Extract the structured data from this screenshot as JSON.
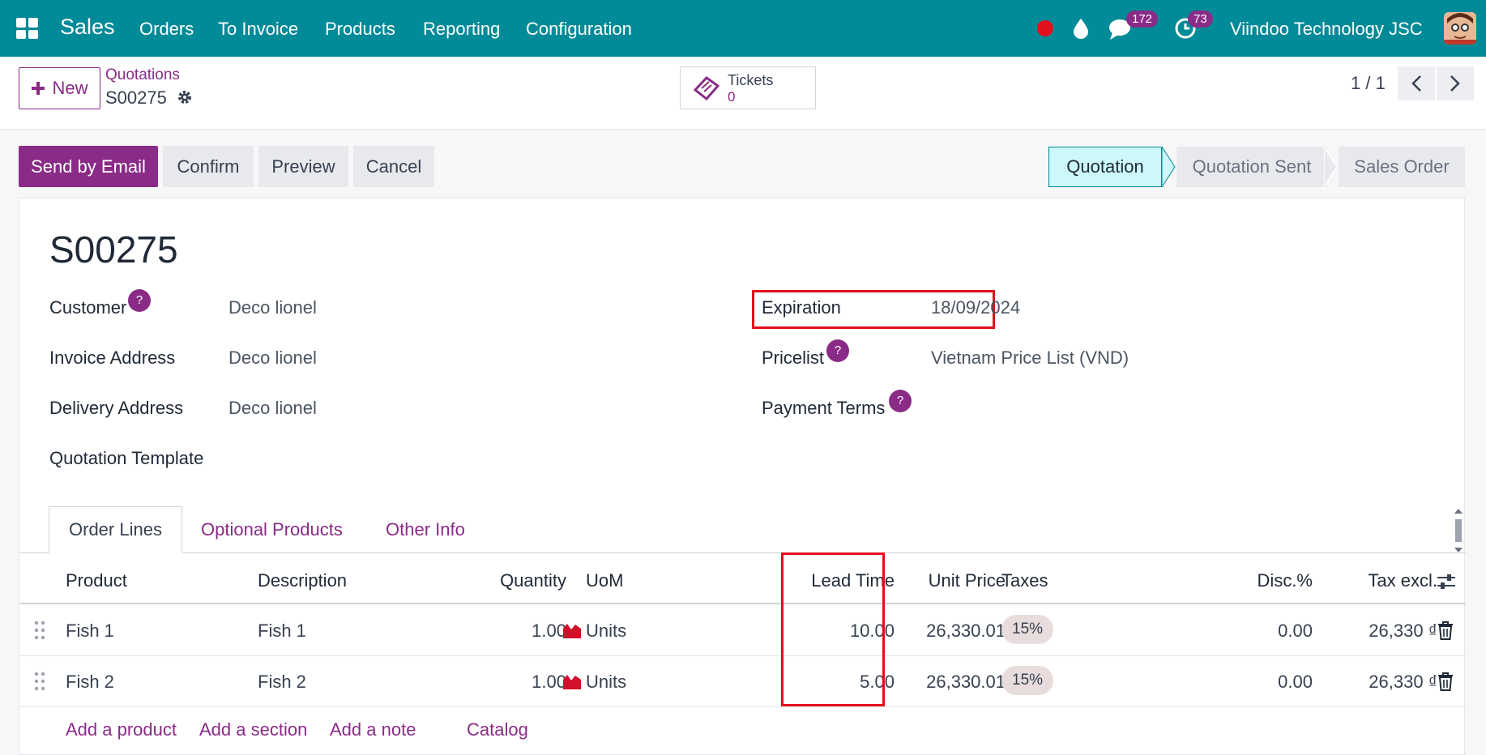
{
  "topbar": {
    "app_name": "Sales",
    "menu": [
      "Orders",
      "To Invoice",
      "Products",
      "Reporting",
      "Configuration"
    ],
    "messages_count": "172",
    "activities_count": "73",
    "company": "Viindoo Technology JSC"
  },
  "control": {
    "new_label": "New",
    "breadcrumb_parent": "Quotations",
    "breadcrumb_current": "S00275",
    "tickets_label": "Tickets",
    "tickets_count": "0",
    "pager": "1 / 1"
  },
  "actions": {
    "send_email": "Send by Email",
    "confirm": "Confirm",
    "preview": "Preview",
    "cancel": "Cancel"
  },
  "statusbar": {
    "stages": [
      "Quotation",
      "Quotation Sent",
      "Sales Order"
    ],
    "active": "Quotation"
  },
  "form": {
    "title": "S00275",
    "customer_label": "Customer",
    "customer_value": "Deco lionel",
    "invoice_address_label": "Invoice Address",
    "invoice_address_value": "Deco lionel",
    "delivery_address_label": "Delivery Address",
    "delivery_address_value": "Deco lionel",
    "quotation_template_label": "Quotation Template",
    "expiration_label": "Expiration",
    "expiration_value": "18/09/2024",
    "pricelist_label": "Pricelist",
    "pricelist_value": "Vietnam Price List (VND)",
    "payment_terms_label": "Payment Terms",
    "help_glyph": "?"
  },
  "tabs": [
    "Order Lines",
    "Optional Products",
    "Other Info"
  ],
  "order_lines": {
    "columns": [
      "Product",
      "Description",
      "Quantity",
      "UoM",
      "Lead Time",
      "Unit Price",
      "Taxes",
      "Disc.%",
      "Tax excl."
    ],
    "rows": [
      {
        "product": "Fish 1",
        "description": "Fish 1",
        "quantity": "1.00",
        "uom": "Units",
        "lead_time": "10.00",
        "unit_price": "26,330.01",
        "taxes": "15%",
        "discount": "0.00",
        "subtotal": "26,330 ₫"
      },
      {
        "product": "Fish 2",
        "description": "Fish 2",
        "quantity": "1.00",
        "uom": "Units",
        "lead_time": "5.00",
        "unit_price": "26,330.01",
        "taxes": "15%",
        "discount": "0.00",
        "subtotal": "26,330 ₫"
      }
    ],
    "add_links": [
      "Add a product",
      "Add a section",
      "Add a note",
      "Catalog"
    ]
  },
  "colors": {
    "topbar": "#018a97",
    "brand": "#8a2b87",
    "highlight_box": "#e0101c"
  },
  "icons": [
    "apps-grid-icon",
    "record-dot-icon",
    "droplet-icon",
    "chat-icon",
    "clock-icon",
    "gear-icon",
    "ticket-icon",
    "chevron-left-icon",
    "chevron-right-icon",
    "forecast-chart-icon",
    "trash-icon",
    "drag-handle-icon",
    "column-settings-icon"
  ]
}
